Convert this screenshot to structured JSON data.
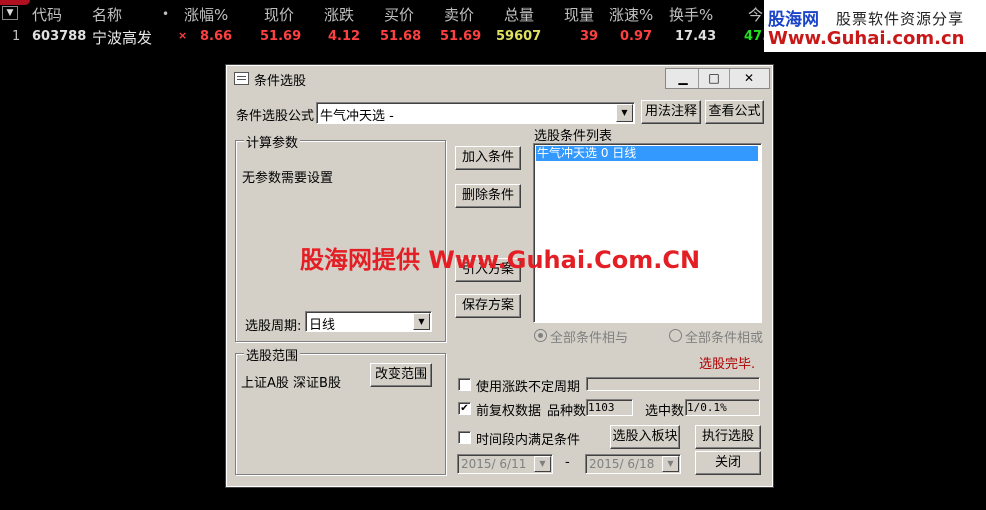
{
  "table": {
    "sort_glyph": "▼",
    "headers": [
      "代码",
      "名称",
      "•",
      "涨幅%",
      "现价",
      "涨跌",
      "买价",
      "卖价",
      "总量",
      "现量",
      "涨速%",
      "换手%",
      "今"
    ],
    "row": {
      "index": "1",
      "code": "603788",
      "name": "宁波高发",
      "mark": "×",
      "change_pct": "8.66",
      "price": "51.69",
      "change": "4.12",
      "bid": "51.68",
      "ask": "51.69",
      "volume": "59607",
      "last_vol": "39",
      "speed": "0.97",
      "turnover": "17.43",
      "today": "47."
    }
  },
  "watermark": {
    "brand": "股海网",
    "slogan": "股票软件资源分享",
    "url": "Www.Guhai.com.cn",
    "overlay": "股海网提供 Www.Guhai.Com.CN"
  },
  "dialog": {
    "title": "条件选股",
    "window_buttons": {
      "minimize": "▁",
      "maximize": "□",
      "close": "✕"
    },
    "formula_label": "条件选股公式",
    "formula_value": "牛气冲天选 -",
    "usage_button": "用法注释",
    "view_button": "查看公式",
    "params_group": "计算参数",
    "params_text": "无参数需要设置",
    "period_label": "选股周期:",
    "period_value": "日线",
    "add_button": "加入条件",
    "delete_button": "删除条件",
    "import_button": "引入方案",
    "save_button": "保存方案",
    "condition_list_label": "选股条件列表",
    "conditions": [
      "牛气冲天选 0 日线"
    ],
    "radio_and": "全部条件相与",
    "radio_or": "全部条件相或",
    "status": "选股完毕.",
    "range_group": "选股范围",
    "range_text": "上证A股 深证B股",
    "change_range_button": "改变范围",
    "uncertain_period_label": "使用涨跌不定周期",
    "uncertain_period_checked": false,
    "adjusted_label": "前复权数据",
    "adjusted_checked": true,
    "count_label": "品种数",
    "count_value": "1103",
    "selected_label": "选中数",
    "selected_value": "1/0.1%",
    "time_range_label": "时间段内满足条件",
    "time_range_checked": false,
    "to_block_button": "选股入板块",
    "execute_button": "执行选股",
    "date_from": "2015/ 6/11",
    "date_sep": "-",
    "date_to": "2015/ 6/18",
    "close_button": "关闭"
  }
}
